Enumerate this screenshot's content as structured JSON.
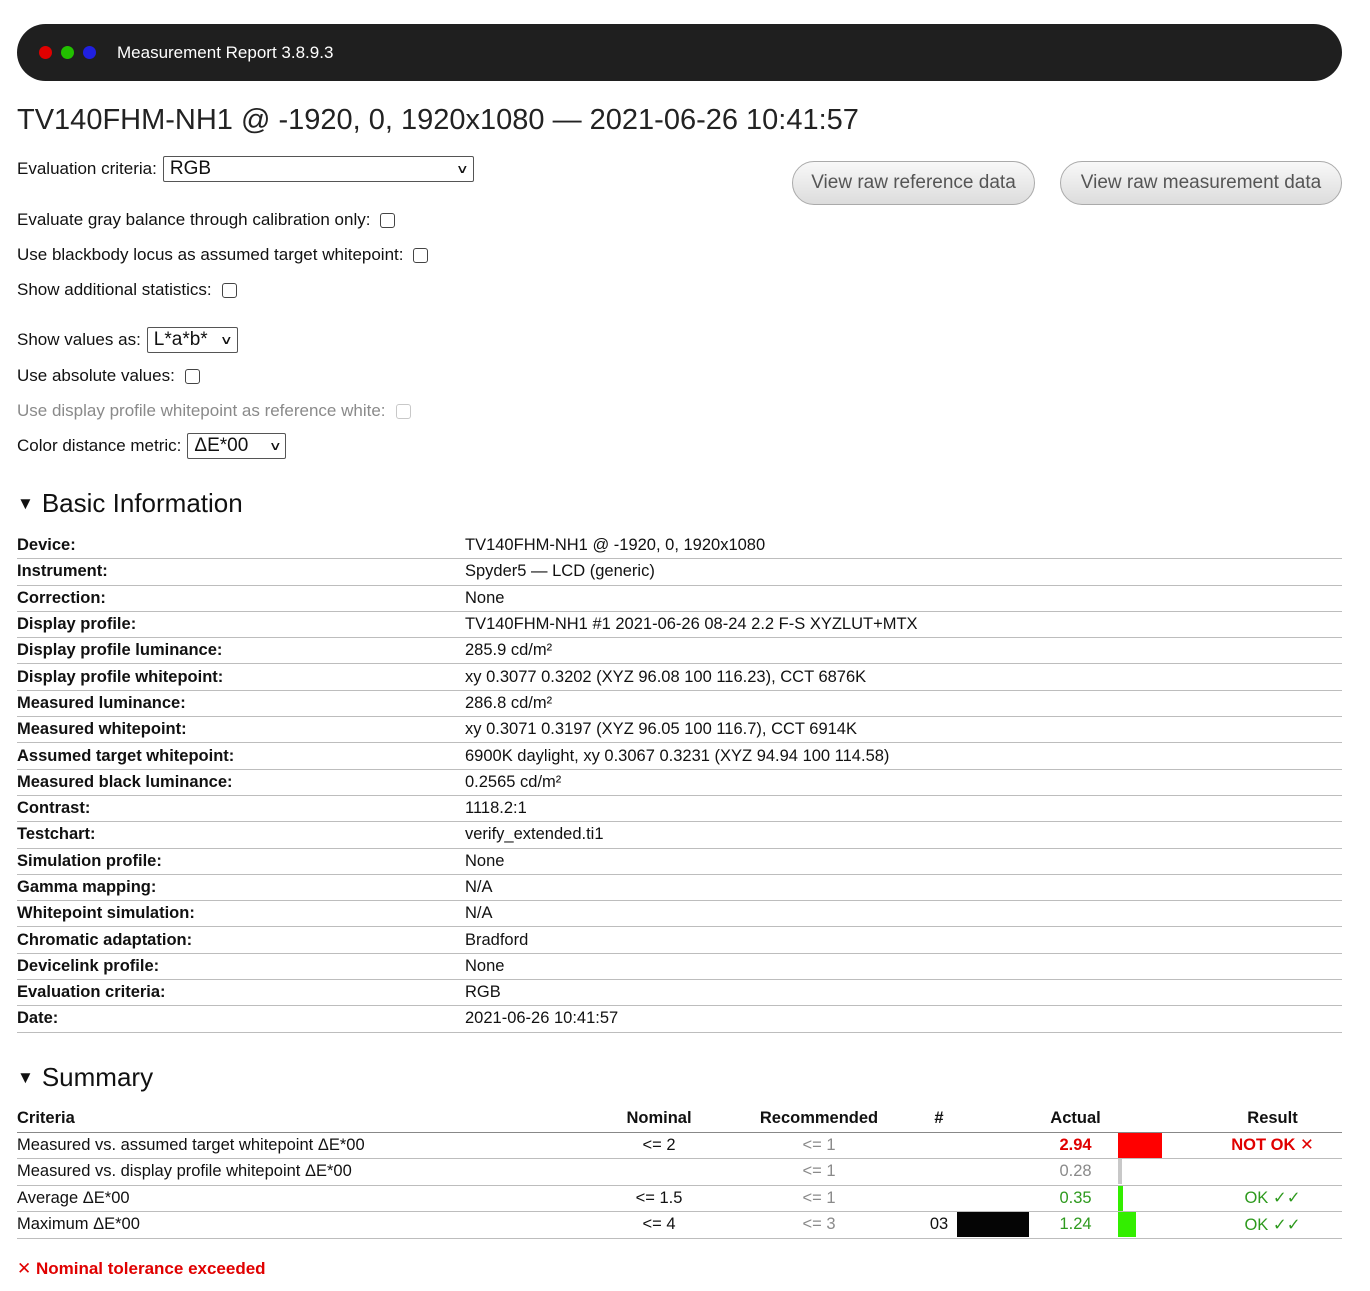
{
  "window": {
    "title": "Measurement Report 3.8.9.3",
    "dot_colors": [
      "#e00000",
      "#22c000",
      "#2020e0"
    ]
  },
  "report_title": "TV140FHM-NH1 @ -1920, 0, 1920x1080 — 2021-06-26 10:41:57",
  "options": {
    "evaluation_criteria": {
      "label": "Evaluation criteria:",
      "value": "RGB"
    },
    "gray_balance": {
      "label": "Evaluate gray balance through calibration only:"
    },
    "blackbody": {
      "label": "Use blackbody locus as assumed target whitepoint:"
    },
    "additional_stats": {
      "label": "Show additional statistics:"
    },
    "show_values_as": {
      "label": "Show values as:",
      "value": "L*a*b*"
    },
    "absolute_values": {
      "label": "Use absolute values:"
    },
    "display_profile_whitepoint": {
      "label": "Use display profile whitepoint as reference white:"
    },
    "color_distance_metric": {
      "label": "Color distance metric:",
      "value": "ΔE*00"
    }
  },
  "buttons": {
    "raw_reference": "View raw reference data",
    "raw_measurement": "View raw measurement data"
  },
  "basic_information": {
    "heading": "Basic Information",
    "rows": [
      {
        "key": "Device:",
        "value": "TV140FHM-NH1 @ -1920, 0, 1920x1080"
      },
      {
        "key": "Instrument:",
        "value": "Spyder5 — LCD (generic)"
      },
      {
        "key": "Correction:",
        "value": "None"
      },
      {
        "key": "Display profile:",
        "value": "TV140FHM-NH1 #1 2021-06-26 08-24 2.2 F-S XYZLUT+MTX"
      },
      {
        "key": "Display profile luminance:",
        "value": "285.9 cd/m²"
      },
      {
        "key": "Display profile whitepoint:",
        "value": "xy 0.3077 0.3202 (XYZ 96.08 100 116.23), CCT 6876K"
      },
      {
        "key": "Measured luminance:",
        "value": "286.8 cd/m²"
      },
      {
        "key": "Measured whitepoint:",
        "value": "xy 0.3071 0.3197 (XYZ 96.05 100 116.7), CCT 6914K"
      },
      {
        "key": "Assumed target whitepoint:",
        "value": "6900K daylight, xy 0.3067 0.3231 (XYZ 94.94 100 114.58)"
      },
      {
        "key": "Measured black luminance:",
        "value": "0.2565 cd/m²"
      },
      {
        "key": "Contrast:",
        "value": "1118.2:1"
      },
      {
        "key": "Testchart:",
        "value": "verify_extended.ti1"
      },
      {
        "key": "Simulation profile:",
        "value": "None"
      },
      {
        "key": "Gamma mapping:",
        "value": "N/A"
      },
      {
        "key": "Whitepoint simulation:",
        "value": "N/A"
      },
      {
        "key": "Chromatic adaptation:",
        "value": "Bradford"
      },
      {
        "key": "Devicelink profile:",
        "value": "None"
      },
      {
        "key": "Evaluation criteria:",
        "value": "RGB"
      },
      {
        "key": "Date:",
        "value": "2021-06-26 10:41:57"
      }
    ]
  },
  "summary": {
    "heading": "Summary",
    "columns": {
      "criteria": "Criteria",
      "nominal": "Nominal",
      "recommended": "Recommended",
      "num": "#",
      "actual": "Actual",
      "result": "Result"
    },
    "rows": [
      {
        "criteria": "Measured vs. assumed target whitepoint ΔE*00",
        "nominal": "<= 2",
        "recommended": "<= 1",
        "num": "",
        "actual": "2.94",
        "result": "NOT OK ✕",
        "status": "fail",
        "bar_fraction": 1.0,
        "bar_color": "#ff0000"
      },
      {
        "criteria": "Measured vs. display profile whitepoint ΔE*00",
        "nominal": "",
        "recommended": "<= 1",
        "num": "",
        "actual": "0.28",
        "result": "",
        "status": "info",
        "bar_fraction": 0.095,
        "bar_color": "#c8c8c8"
      },
      {
        "criteria": "Average ΔE*00",
        "nominal": "<= 1.5",
        "recommended": "<= 1",
        "num": "",
        "actual": "0.35",
        "result": "OK ✓✓",
        "status": "ok",
        "bar_fraction": 0.12,
        "bar_color": "#33ee00"
      },
      {
        "criteria": "Maximum ΔE*00",
        "nominal": "<= 4",
        "recommended": "<= 3",
        "num": "03",
        "actual": "1.24",
        "result": "OK ✓✓",
        "status": "ok",
        "bar_fraction": 0.42,
        "bar_color": "#33ee00",
        "swatch_color": "#050505"
      }
    ]
  },
  "footer": "✕ Nominal tolerance exceeded"
}
